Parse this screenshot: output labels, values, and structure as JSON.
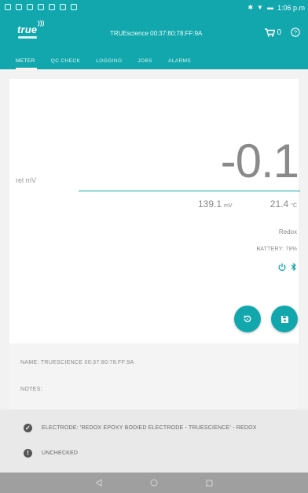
{
  "statusbar": {
    "time": "1:06 p.m"
  },
  "appbar": {
    "logo": "true",
    "device_title": "TRUEscience 00:37:80:78:FF:9A",
    "cart_count": "0"
  },
  "tabs": [
    {
      "label": "METER",
      "active": true
    },
    {
      "label": "QC CHECK",
      "active": false
    },
    {
      "label": "LOGGING",
      "active": false
    },
    {
      "label": "JOBS",
      "active": false
    },
    {
      "label": "ALARMS",
      "active": false
    }
  ],
  "meter": {
    "reading_label": "rel mV",
    "reading_value": "-0.1",
    "mv_value": "139.1",
    "mv_unit": "mV",
    "temp_value": "21.4",
    "temp_unit": "°C",
    "mode": "Redox",
    "battery": "BATTERY: 78%"
  },
  "info": {
    "name": "NAME: TRUESCIENCE 00:37:80:78:FF:9A",
    "notes": "NOTES:"
  },
  "electrode": {
    "electrode_line": "ELECTRODE: 'REDOX EPOXY BODIED ELECTRODE - TRUESCIENCE' - REDOX",
    "check_status": "UNCHECKED"
  },
  "colors": {
    "accent": "#12a7ac"
  }
}
